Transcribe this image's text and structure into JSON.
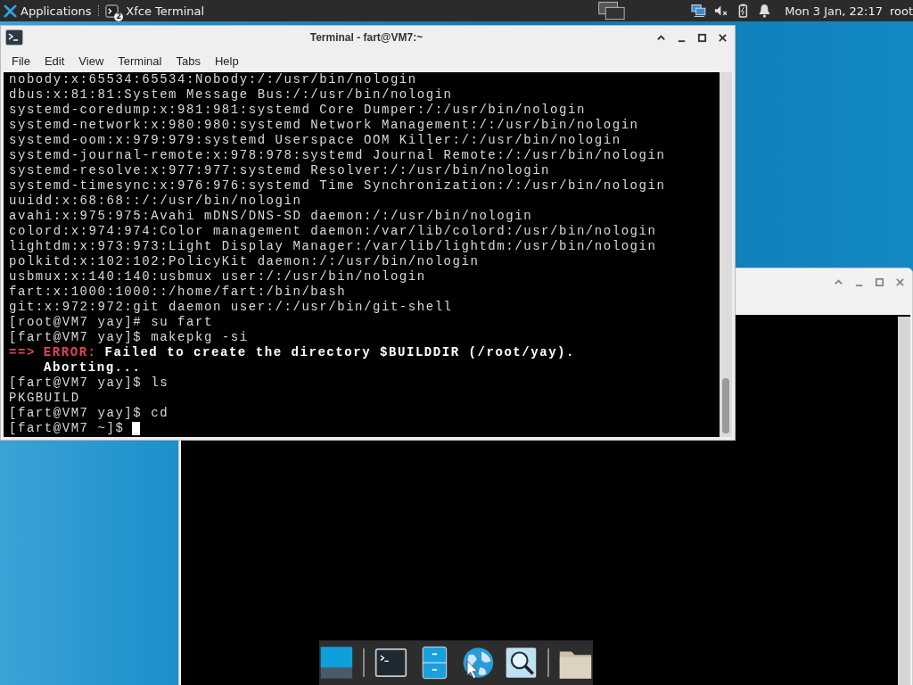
{
  "top_panel": {
    "applications_label": "Applications",
    "tasks": [
      {
        "label": "Xfce Terminal",
        "badge": "2",
        "selected": false
      }
    ],
    "clock": "Mon 3 Jan, 22:17",
    "user": "root"
  },
  "terminal_window": {
    "title": "Terminal - fart@VM7:~",
    "menu": [
      "File",
      "Edit",
      "View",
      "Terminal",
      "Tabs",
      "Help"
    ],
    "lines": [
      {
        "kind": "plain",
        "text": "nobody:x:65534:65534:Nobody:/:/usr/bin/nologin"
      },
      {
        "kind": "plain",
        "text": "dbus:x:81:81:System Message Bus:/:/usr/bin/nologin"
      },
      {
        "kind": "plain",
        "text": "systemd-coredump:x:981:981:systemd Core Dumper:/:/usr/bin/nologin"
      },
      {
        "kind": "plain",
        "text": "systemd-network:x:980:980:systemd Network Management:/:/usr/bin/nologin"
      },
      {
        "kind": "plain",
        "text": "systemd-oom:x:979:979:systemd Userspace OOM Killer:/:/usr/bin/nologin"
      },
      {
        "kind": "plain",
        "text": "systemd-journal-remote:x:978:978:systemd Journal Remote:/:/usr/bin/nologin"
      },
      {
        "kind": "plain",
        "text": "systemd-resolve:x:977:977:systemd Resolver:/:/usr/bin/nologin"
      },
      {
        "kind": "plain",
        "text": "systemd-timesync:x:976:976:systemd Time Synchronization:/:/usr/bin/nologin"
      },
      {
        "kind": "plain",
        "text": "uuidd:x:68:68::/:/usr/bin/nologin"
      },
      {
        "kind": "plain",
        "text": "avahi:x:975:975:Avahi mDNS/DNS-SD daemon:/:/usr/bin/nologin"
      },
      {
        "kind": "plain",
        "text": "colord:x:974:974:Color management daemon:/var/lib/colord:/usr/bin/nologin"
      },
      {
        "kind": "plain",
        "text": "lightdm:x:973:973:Light Display Manager:/var/lib/lightdm:/usr/bin/nologin"
      },
      {
        "kind": "plain",
        "text": "polkitd:x:102:102:PolicyKit daemon:/:/usr/bin/nologin"
      },
      {
        "kind": "plain",
        "text": "usbmux:x:140:140:usbmux user:/:/usr/bin/nologin"
      },
      {
        "kind": "plain",
        "text": "fart:x:1000:1000::/home/fart:/bin/bash"
      },
      {
        "kind": "plain",
        "text": "git:x:972:972:git daemon user:/:/usr/bin/git-shell"
      },
      {
        "kind": "plain",
        "text": "[root@VM7 yay]# su fart"
      },
      {
        "kind": "plain",
        "text": "[fart@VM7 yay]$ makepkg -si"
      },
      {
        "kind": "error",
        "marker": "==>",
        "label": "ERROR:",
        "text": "Failed to create the directory $BUILDDIR (/root/yay)."
      },
      {
        "kind": "continuation",
        "text": "Aborting..."
      },
      {
        "kind": "plain",
        "text": "[fart@VM7 yay]$ ls"
      },
      {
        "kind": "plain",
        "text": "PKGBUILD"
      },
      {
        "kind": "plain",
        "text": "[fart@VM7 yay]$ cd"
      },
      {
        "kind": "plain",
        "text": "[fart@VM7 ~]$"
      }
    ],
    "cursor": true
  },
  "dock": {
    "items": [
      {
        "kind": "workspace"
      },
      {
        "kind": "separator"
      },
      {
        "kind": "terminal"
      },
      {
        "kind": "cabinet"
      },
      {
        "kind": "globe"
      },
      {
        "kind": "search"
      },
      {
        "kind": "separator"
      },
      {
        "kind": "folder"
      }
    ]
  }
}
